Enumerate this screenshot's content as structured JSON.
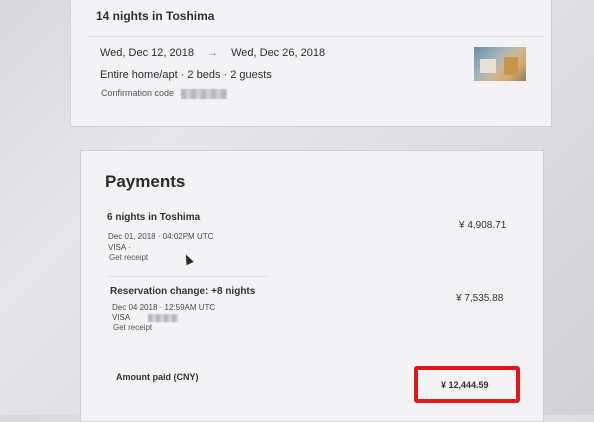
{
  "trip": {
    "title": "14 nights in Toshima",
    "check_in": "Wed, Dec 12, 2018",
    "arrow": "→",
    "check_out": "Wed, Dec 26, 2018",
    "listing": "Entire home/apt · 2 beds · 2 guests",
    "confirmation_label": "Confirmation code"
  },
  "payments": {
    "title": "Payments",
    "items": [
      {
        "title": "6 nights in Toshima",
        "date": "Dec 01, 2018 · 04:02PM UTC",
        "method": "VISA ·",
        "link": "Get receipt",
        "amount": "¥ 4,908.71"
      },
      {
        "title": "Reservation change: +8 nights",
        "date_prefix": "Dec 04",
        "date_suffix": "2018 · 12:59AM UTC",
        "method": "VISA",
        "link": "Get receipt",
        "amount": "¥ 7,535.88"
      }
    ],
    "paid_label": "Amount paid (CNY)",
    "total": "¥ 12,444.59"
  },
  "colors": {
    "highlight": "#e3161c",
    "card": "#f3f3f5"
  }
}
